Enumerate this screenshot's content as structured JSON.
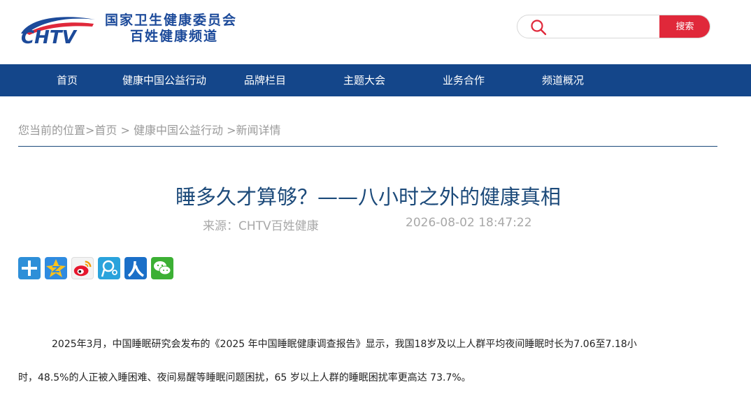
{
  "brand": {
    "logo_text": "CHTV",
    "line1": "国家卫生健康委员会",
    "line2": "百姓健康频道"
  },
  "search": {
    "placeholder": "",
    "button_label": "搜索",
    "icon": "search-icon"
  },
  "nav": {
    "items": [
      "首页",
      "健康中国公益行动",
      "品牌栏目",
      "主题大会",
      "业务合作",
      "频道概况"
    ]
  },
  "breadcrumb": {
    "text": "您当前的位置>首页 > 健康中国公益行动 >新闻详情"
  },
  "article": {
    "title": "睡多久才算够？——八小时之外的健康真相",
    "source": "来源：CHTV百姓健康",
    "time": "2026-08-02 18:47:22",
    "para1_line1": "2025年3月，中国睡眠研究会发布的《2025 年中国睡眠健康调查报告》显示，我国18岁及以上人群平均夜间睡眠时长为7.06至7.18小",
    "para1_line2": "时，48.5%的人正被入睡困难、夜间易醒等睡眠问题困扰，65 岁以上人群的睡眠困扰率更高达 73.7%。"
  },
  "share": {
    "icons": [
      "more-share-icon",
      "qzone-icon",
      "weibo-icon",
      "tencent-weibo-icon",
      "renren-icon",
      "wechat-icon"
    ]
  },
  "colors": {
    "nav_bg": "#14468a",
    "brand_blue": "#1c4a9a",
    "search_red": "#e0283a",
    "title_blue": "#1c4a7a"
  }
}
